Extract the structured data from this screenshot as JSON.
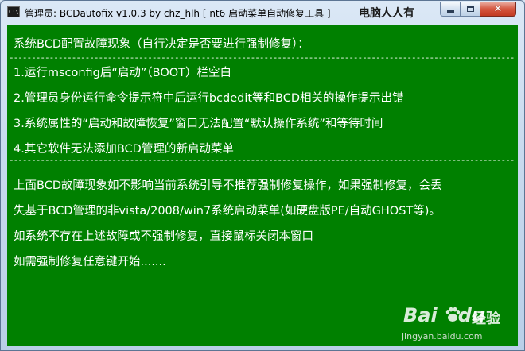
{
  "window": {
    "title": "管理员:  BCDautofix v1.0.3 by chz_hlh    [ nt6 启动菜单自动修复工具 ]",
    "brand": "电脑人人有",
    "icon_text": "C:\\"
  },
  "controls": {
    "minimize_icon": "minimize-icon",
    "maximize_icon": "maximize-icon",
    "close_icon": "close-icon",
    "close_glyph": "✕"
  },
  "console": {
    "background_color": "#008000",
    "text_color": "#ffffff",
    "header": "系统BCD配置故障现象（自行决定是否要进行强制修复）：",
    "issues": [
      "1.运行msconfig后“启动”（BOOT）栏空白",
      "2.管理员身份运行命令提示符中后运行bcdedit等和BCD相关的操作提示出错",
      "3.系统属性的“启动和故障恢复”窗口无法配置“默认操作系统”和等待时间",
      "4.其它软件无法添加BCD管理的新启动菜单"
    ],
    "warning_line1": "上面BCD故障现象如不影响当前系统引导不推荐强制修复操作，如果强制修复，会丢",
    "warning_line2": "失基于BCD管理的非vista/2008/win7系统启动菜单(如硬盘版PE/自动GHOST等)。",
    "close_hint": "如系统不存在上述故障或不强制修复，直接鼠标关闭本窗口",
    "prompt": "如需强制修复任意键开始......."
  },
  "watermark": {
    "logo": "Bai",
    "logo2": "du",
    "service": "经验",
    "url": "jingyan.baidu.com"
  }
}
